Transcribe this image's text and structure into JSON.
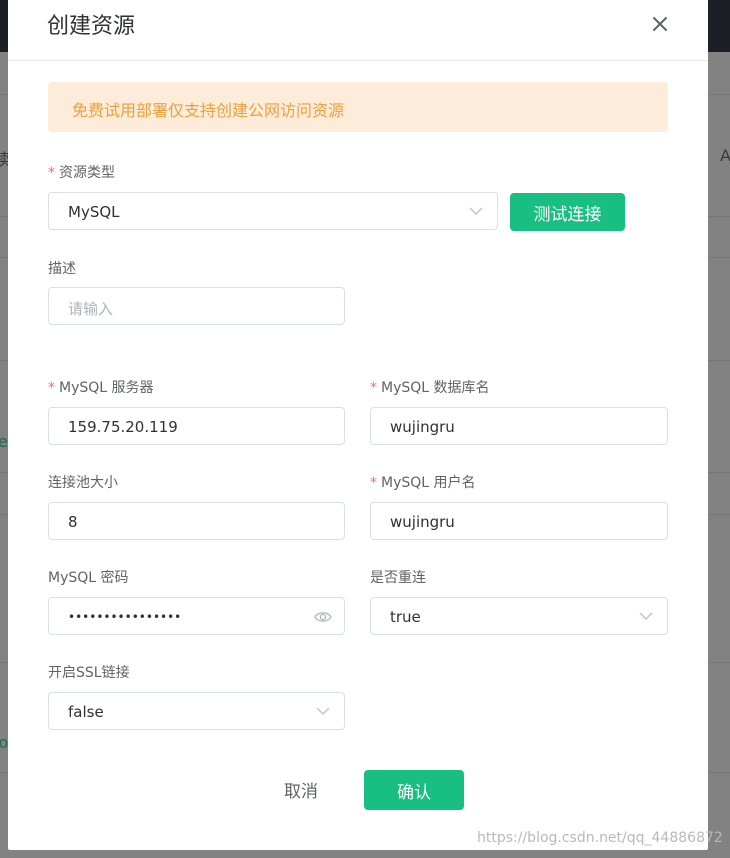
{
  "dialog": {
    "title": "创建资源",
    "alert": "免费试用部署仅支持创建公网访问资源"
  },
  "form": {
    "resource_type": {
      "label": "资源类型",
      "value": "MySQL"
    },
    "test_button": "测试连接",
    "description": {
      "label": "描述",
      "placeholder": "请输入"
    },
    "server": {
      "label": "MySQL 服务器",
      "value": "159.75.20.119"
    },
    "database": {
      "label": "MySQL 数据库名",
      "value": "wujingru"
    },
    "pool_size": {
      "label": "连接池大小",
      "value": "8"
    },
    "username": {
      "label": "MySQL 用户名",
      "value": "wujingru"
    },
    "password": {
      "label": "MySQL 密码",
      "value": "••••••••••••••••"
    },
    "reconnect": {
      "label": "是否重连",
      "value": "true"
    },
    "ssl": {
      "label": "开启SSL链接",
      "value": "false"
    }
  },
  "footer": {
    "cancel": "取消",
    "confirm": "确认"
  },
  "watermark": "https://blog.csdn.net/qq_44886872",
  "background": {
    "edge_text_1": "读",
    "edge_text_2": "A",
    "edge_text_3": "e",
    "edge_text_4": "lo"
  },
  "colors": {
    "primary": "#19be83",
    "alert_bg": "#fdecd9",
    "alert_text": "#e8a13d",
    "required": "#f56c6c"
  }
}
